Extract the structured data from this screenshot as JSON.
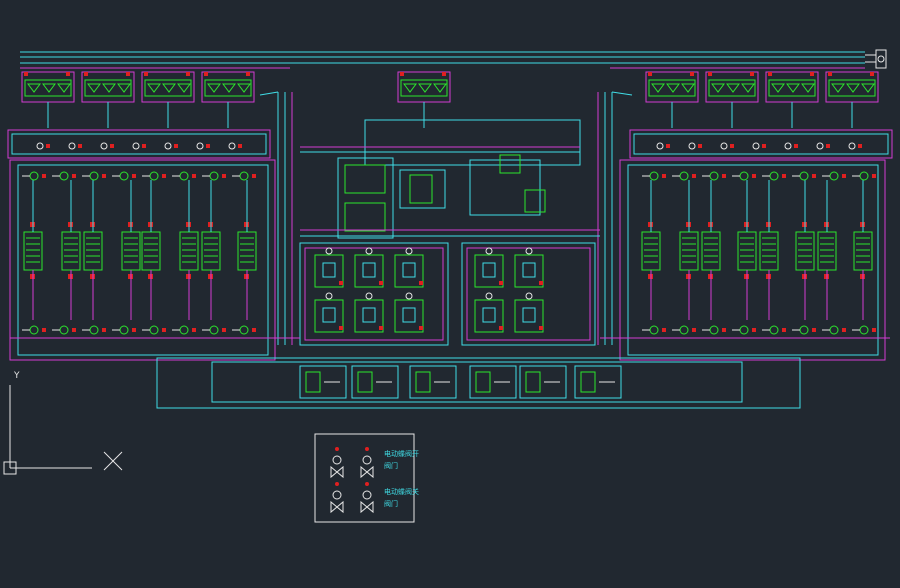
{
  "colors": {
    "background": "#212830",
    "pipe_cyan": "#40dde6",
    "pipe_magenta": "#d23cd2",
    "equipment_green": "#2ce62c",
    "valve_red": "#e02020",
    "white": "#e6e6e6",
    "blue": "#4a6cff"
  },
  "legend": {
    "entries": [
      {
        "text": "电动蝶阀开",
        "sub": "阀门"
      },
      {
        "text": "电动蝶阀关",
        "sub": "阀门"
      }
    ]
  },
  "ucs": {
    "x_label": "X",
    "y_label": "Y"
  }
}
